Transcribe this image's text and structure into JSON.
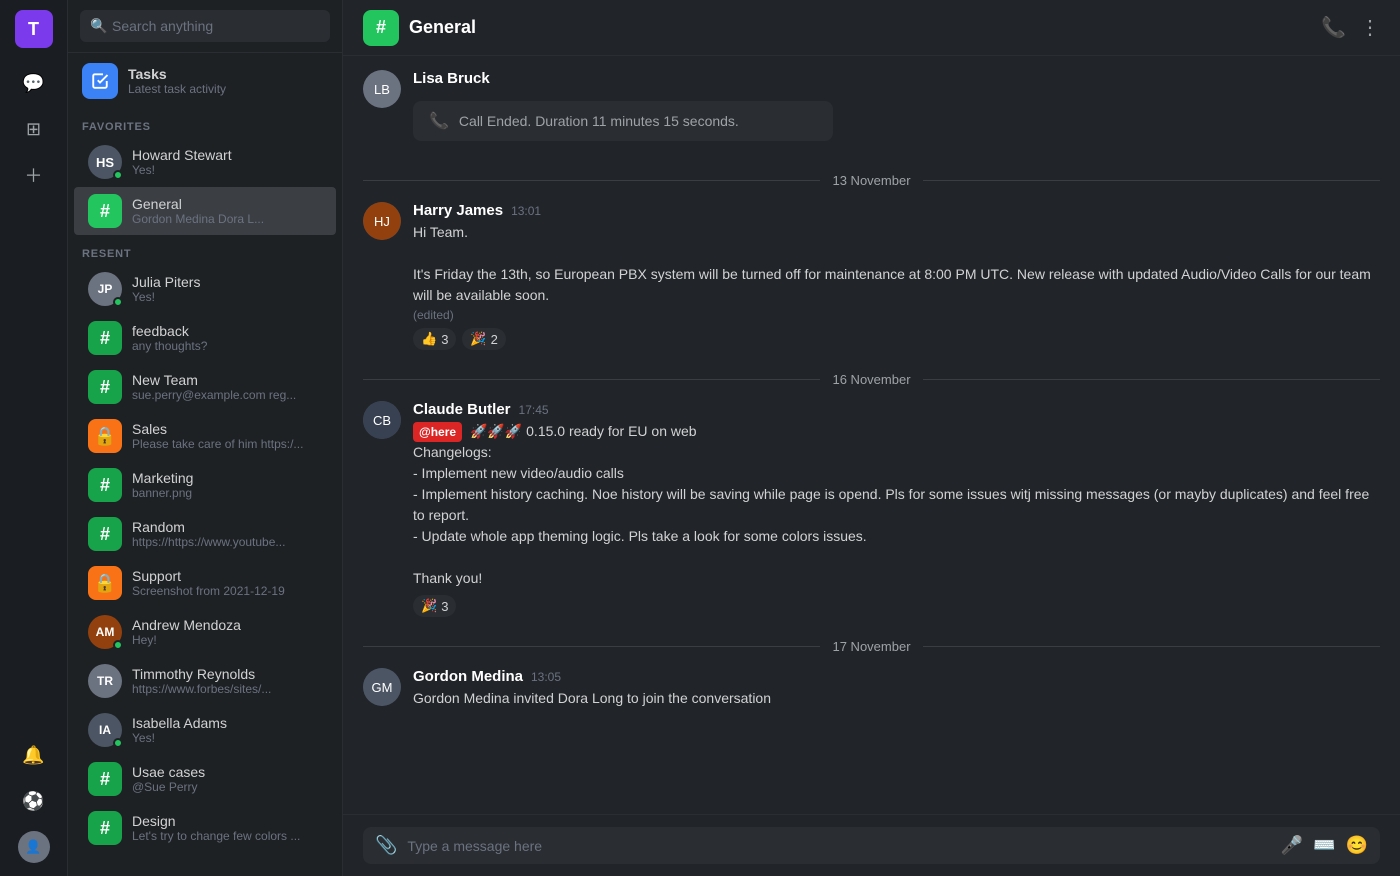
{
  "iconBar": {
    "userInitial": "T",
    "icons": [
      "💬",
      "📋",
      "➕"
    ]
  },
  "sidebar": {
    "searchPlaceholder": "Search anything",
    "tasksTitle": "Tasks",
    "tasksSubtitle": "Latest task activity",
    "favoritesLabel": "FAVORITES",
    "favorites": [
      {
        "name": "Howard Stewart",
        "preview": "Yes!",
        "type": "user",
        "online": true
      },
      {
        "name": "General",
        "preview": "Gordon Medina Dora L...",
        "type": "channel",
        "color": "green",
        "active": true
      }
    ],
    "recentLabel": "RESENT",
    "recent": [
      {
        "name": "Julia Piters",
        "preview": "Yes!",
        "type": "user",
        "online": true
      },
      {
        "name": "feedback",
        "preview": "any thoughts?",
        "type": "channel",
        "color": "green-dark"
      },
      {
        "name": "New Team",
        "preview": "sue.perry@example.com reg...",
        "type": "channel",
        "color": "green-dark"
      },
      {
        "name": "Sales",
        "preview": "Please take care of him https:/...",
        "type": "channel",
        "color": "orange"
      },
      {
        "name": "Marketing",
        "preview": "banner.png",
        "type": "channel",
        "color": "green-dark"
      },
      {
        "name": "Random",
        "preview": "https://https://www.youtube...",
        "type": "channel",
        "color": "green-dark"
      },
      {
        "name": "Support",
        "preview": "Screenshot from 2021-12-19",
        "type": "channel",
        "color": "orange"
      },
      {
        "name": "Andrew Mendoza",
        "preview": "Hey!",
        "type": "user",
        "online": true
      },
      {
        "name": "Timmothy Reynolds",
        "preview": "https://www.forbes/sites/...",
        "type": "user",
        "online": false
      },
      {
        "name": "Isabella Adams",
        "preview": "Yes!",
        "type": "user",
        "online": true
      },
      {
        "name": "Usae cases",
        "preview": "@Sue Perry",
        "type": "channel",
        "color": "green-dark"
      },
      {
        "name": "Design",
        "preview": "Let's try to change few colors ...",
        "type": "channel",
        "color": "green-dark"
      }
    ]
  },
  "chat": {
    "channelName": "General",
    "callEndedText": "Call Ended. Duration 11 minutes 15 seconds.",
    "senderAbove": "Lisa Bruck",
    "dates": {
      "date1": "13 November",
      "date2": "16  November",
      "date3": "17  November"
    },
    "messages": [
      {
        "id": "msg1",
        "author": "Harry James",
        "time": "13:01",
        "lines": [
          "Hi Team.",
          "",
          "It's Friday the 13th, so European PBX system will be turned off for maintenance at 8:00 PM UTC. New release with updated Audio/Video Calls for our team will be available soon."
        ],
        "edited": "(edited)",
        "reactions": [
          {
            "emoji": "👍",
            "count": "3"
          },
          {
            "emoji": "🎉",
            "count": "2"
          }
        ]
      },
      {
        "id": "msg2",
        "author": "Claude Butler",
        "time": "17:45",
        "here": "@here",
        "lines": [
          "🚀🚀🚀 0.15.0 ready for EU on web",
          "Changelogs:",
          "- Implement new video/audio calls",
          "- Implement history caching. Noe history will be saving while page is opend. Pls for some issues witj missing messages (or mayby duplicates) and  feel free to report.",
          "- Update whole app theming logic. Pls take a look for some colors issues.",
          "",
          "Thank you!"
        ],
        "reactions": [
          {
            "emoji": "🎉",
            "count": "3"
          }
        ]
      },
      {
        "id": "msg3",
        "author": "Gordon Medina",
        "time": "13:05",
        "lines": [
          "Gordon Medina invited Dora Long to join the conversation"
        ],
        "reactions": []
      }
    ],
    "inputPlaceholder": "Type a message here"
  }
}
